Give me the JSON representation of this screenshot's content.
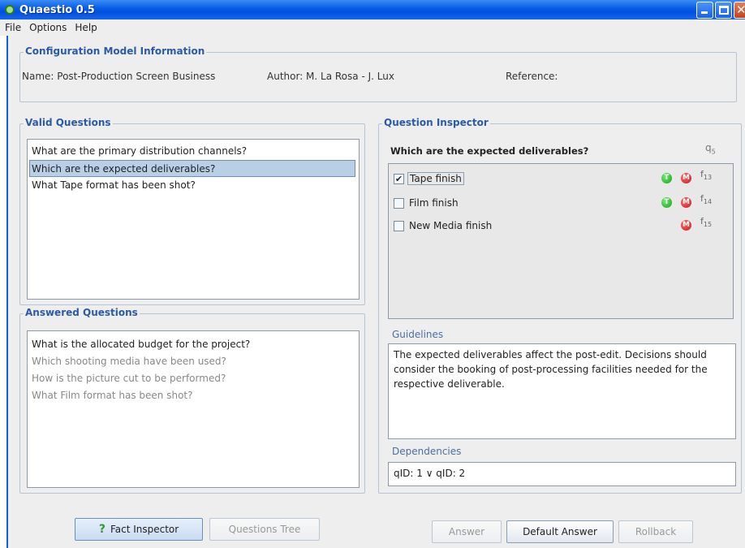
{
  "window": {
    "title": "Quaestio 0.5"
  },
  "menu": {
    "items": [
      "File",
      "Options",
      "Help"
    ]
  },
  "config": {
    "title": "Configuration Model Information",
    "name": "Name: Post-Production Screen Business",
    "author": "Author: M. La Rosa - J. Lux",
    "reference": "Reference:"
  },
  "valid_questions": {
    "title": "Valid Questions",
    "items": [
      "What are the primary distribution channels?",
      "Which are the expected deliverables?",
      "What Tape format has been shot?"
    ],
    "selected_index": 1
  },
  "answered_questions": {
    "title": "Answered Questions",
    "items": [
      "What is the allocated budget for the project?",
      "Which shooting media have been used?",
      "How is the picture cut to be performed?",
      "What Film format has been shot?"
    ]
  },
  "inspector": {
    "title": "Question Inspector",
    "question": "Which are the expected deliverables?",
    "qid_base": "q",
    "qid_sub": "5",
    "facts": [
      {
        "label": "Tape finish",
        "checked": true,
        "badge_t": "T",
        "badge_m": "M",
        "id_base": "f",
        "id_sub": "13"
      },
      {
        "label": "Film finish",
        "checked": false,
        "badge_t": "T",
        "badge_m": "M",
        "id_base": "f",
        "id_sub": "14"
      },
      {
        "label": "New Media finish",
        "checked": false,
        "badge_t": "",
        "badge_m": "M",
        "id_base": "f",
        "id_sub": "15"
      }
    ],
    "guidelines_label": "Guidelines",
    "guidelines_text": "The expected deliverables affect the post-edit. Decisions should consider the booking of post-processing facilities needed for the respective deliverable.",
    "dependencies_label": "Dependencies",
    "dependencies_text": "qID: 1 ∨ qID: 2"
  },
  "buttons": {
    "fact_inspector": "Fact Inspector",
    "questions_tree": "Questions Tree",
    "answer": "Answer",
    "default_answer": "Default Answer",
    "rollback": "Rollback"
  },
  "colors": {
    "titlebar": "#0b5fe8",
    "group_title": "#2a5aa8",
    "selection": "#b8cfe5",
    "badge_t": "#14a514",
    "badge_m": "#c81a1a"
  }
}
